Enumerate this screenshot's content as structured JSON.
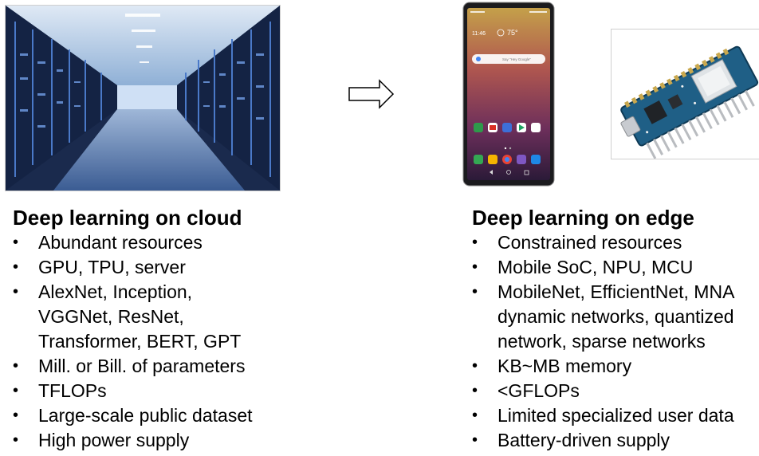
{
  "left": {
    "heading": "Deep learning on cloud",
    "items": [
      [
        "Abundant resources"
      ],
      [
        "GPU, TPU, server"
      ],
      [
        "AlexNet, Inception,",
        "VGGNet,  ResNet,",
        "Transformer, BERT, GPT"
      ],
      [
        "Mill. or Bill. of parameters"
      ],
      [
        "TFLOPs"
      ],
      [
        "Large-scale public dataset"
      ],
      [
        "High power supply"
      ]
    ]
  },
  "right": {
    "heading": "Deep learning on edge",
    "items": [
      [
        "Constrained resources"
      ],
      [
        "Mobile SoC, NPU, MCU"
      ],
      [
        "MobileNet, EfficientNet, MNA",
        "dynamic networks, quantized",
        "network, sparse networks"
      ],
      [
        "KB~MB memory"
      ],
      [
        "<GFLOPs"
      ],
      [
        "Limited specialized user data"
      ],
      [
        "Battery-driven supply"
      ]
    ]
  },
  "phone": {
    "temperature": "75°",
    "search_placeholder": "Say \"Hey Google\""
  },
  "icons": {
    "datacenter": "server-racks-photo",
    "arrow": "right-arrow-icon",
    "phone": "smartphone-photo",
    "board": "microcontroller-board-photo"
  }
}
